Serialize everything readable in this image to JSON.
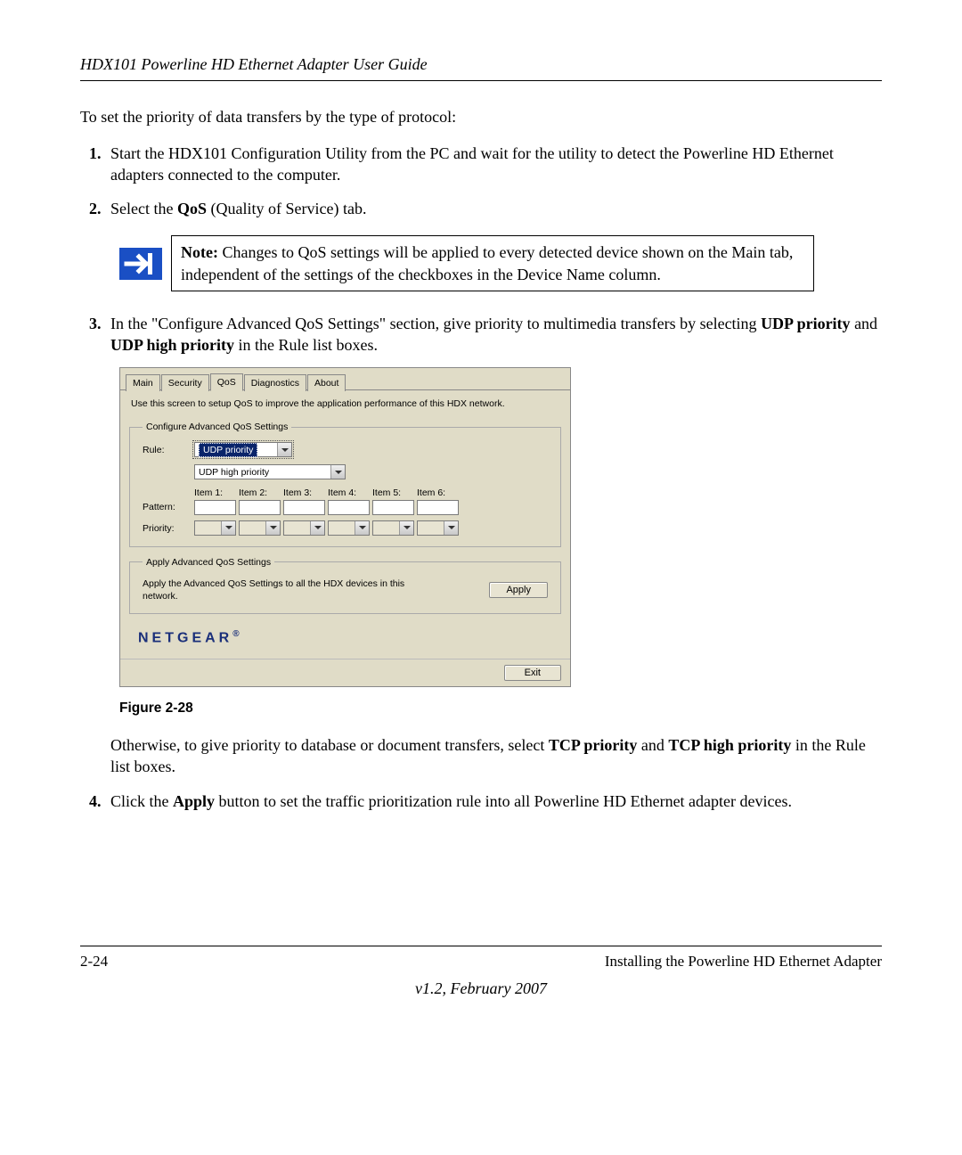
{
  "header": {
    "title": "HDX101 Powerline HD Ethernet Adapter User Guide"
  },
  "intro": "To set the priority of data transfers by the type of protocol:",
  "steps": {
    "s1": "Start the HDX101 Configuration Utility from the PC and wait for the utility to detect the Powerline HD Ethernet adapters connected to the computer.",
    "s2_pre": "Select the ",
    "s2_bold": "QoS",
    "s2_post": " (Quality of Service) tab.",
    "note_bold": "Note:",
    "note_text": " Changes to QoS settings will be applied to every detected device shown on the Main tab, independent of the settings of the checkboxes in the Device Name column.",
    "s3_pre": "In the \"Configure Advanced QoS Settings\" section, give priority to multimedia transfers by selecting ",
    "s3_b1": "UDP priority",
    "s3_mid": " and ",
    "s3_b2": "UDP high priority",
    "s3_post": " in the Rule list boxes.",
    "s3_sub_pre": "Otherwise, to give priority to database or document transfers, select ",
    "s3_sub_b1": "TCP priority",
    "s3_sub_mid": " and ",
    "s3_sub_b2": "TCP high priority",
    "s3_sub_post": " in the Rule list boxes.",
    "s4_pre": "Click the ",
    "s4_bold": "Apply",
    "s4_post": " button to set the traffic prioritization rule into all Powerline HD Ethernet adapter devices."
  },
  "figure_caption": "Figure 2-28",
  "screenshot": {
    "tabs": [
      "Main",
      "Security",
      "QoS",
      "Diagnostics",
      "About"
    ],
    "active_tab_index": 2,
    "description": "Use this screen to setup QoS to improve the application performance of this HDX network.",
    "group1_legend": "Configure Advanced QoS Settings",
    "rule_label": "Rule:",
    "rule_value": "UDP priority",
    "rule2_value": "UDP high priority",
    "item_labels": [
      "Item 1:",
      "Item 2:",
      "Item 3:",
      "Item 4:",
      "Item 5:",
      "Item 6:"
    ],
    "pattern_label": "Pattern:",
    "priority_label": "Priority:",
    "group2_legend": "Apply Advanced QoS Settings",
    "apply_text": "Apply the Advanced QoS Settings to all the HDX devices in this network.",
    "apply_btn": "Apply",
    "logo": "NETGEAR",
    "exit_btn": "Exit"
  },
  "footer": {
    "page": "2-24",
    "section": "Installing the Powerline HD Ethernet Adapter",
    "version": "v1.2, February 2007"
  }
}
